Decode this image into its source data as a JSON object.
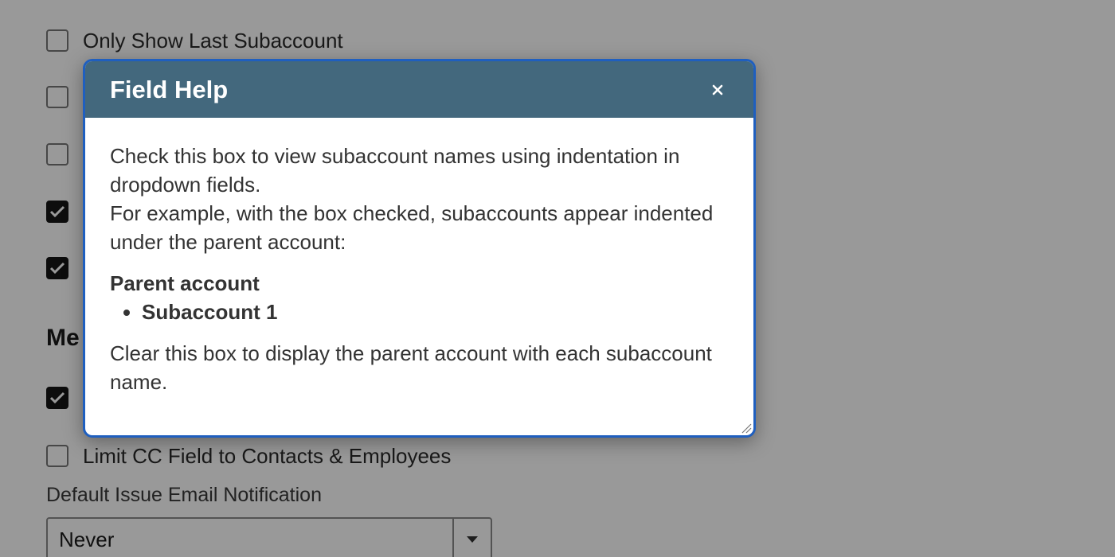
{
  "background": {
    "checkboxes": [
      {
        "label": "Only Show Last Subaccount",
        "checked": false
      },
      {
        "label": "",
        "checked": false
      },
      {
        "label": "",
        "checked": false
      },
      {
        "label": "",
        "checked": true
      },
      {
        "label": "",
        "checked": true
      }
    ],
    "section_heading": "Me",
    "section_checkboxes": [
      {
        "label": "",
        "checked": true
      },
      {
        "label": "Limit CC Field to Contacts & Employees",
        "checked": false
      }
    ],
    "notification_field": {
      "label": "Default Issue Email Notification",
      "value": "Never"
    }
  },
  "dialog": {
    "title": "Field Help",
    "close_label": "×",
    "para1": "Check this box to view subaccount names using indentation in dropdown fields.",
    "para2": "For example, with the box checked, subaccounts appear indented under the parent account:",
    "example_parent": "Parent account",
    "example_items": [
      "Subaccount 1"
    ],
    "para3": "Clear this box to display the parent account with each subaccount name."
  },
  "colors": {
    "dialog_header": "#43687d",
    "dialog_border": "#1f5fbf",
    "overlay": "rgba(0,0,0,0.40)"
  },
  "icons": {
    "checkmark": "checkmark-icon",
    "close": "close-icon",
    "dropdown": "chevron-down-icon",
    "resize": "resize-grip-icon"
  }
}
